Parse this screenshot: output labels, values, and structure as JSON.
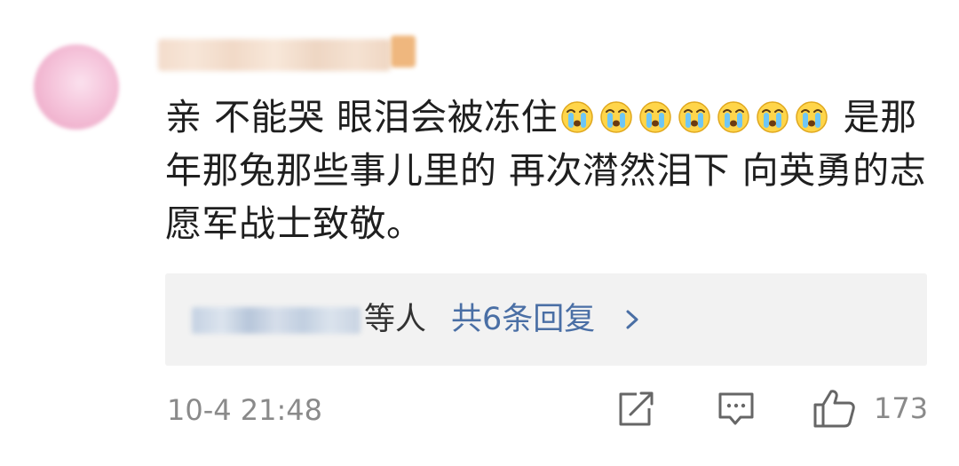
{
  "comment": {
    "text_line1_before_emoji": "亲 不能哭 眼泪会被冻住",
    "cry_emoji_count": 7,
    "text_after_emoji": " 是那年那兔那些事儿里的 再次潸然泪下 向英勇的志愿军战士致敬。",
    "timestamp": "10-4 21:48"
  },
  "replies": {
    "suffix": "等人",
    "count_label": "共6条回复"
  },
  "actions": {
    "share_icon": "share-icon",
    "comment_icon": "comment-icon",
    "like_icon": "thumbs-up-icon",
    "like_count": "173"
  },
  "colors": {
    "link": "#4a6fa5",
    "text": "#1f1f1f",
    "muted": "#8a8a8a",
    "reply_bg": "#f2f2f2"
  }
}
